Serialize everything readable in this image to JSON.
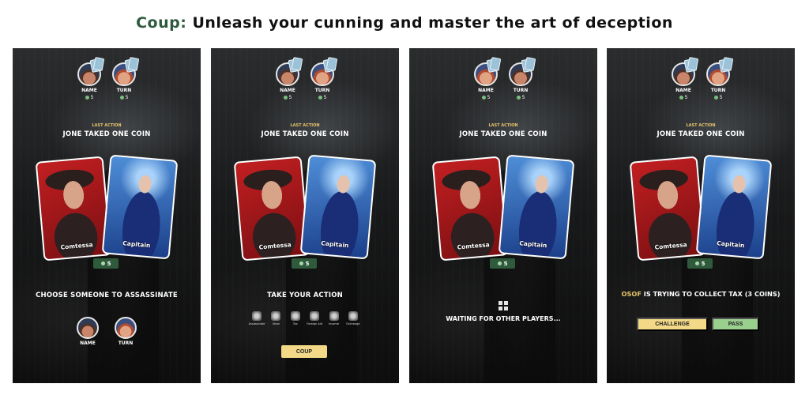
{
  "header": {
    "brand": "Coup:",
    "tagline": "Unleash your cunning and master the art of deception"
  },
  "players": [
    {
      "name": "Name",
      "coins": "5"
    },
    {
      "name": "Turn",
      "coins": "5"
    }
  ],
  "last_action": {
    "label": "Last Action",
    "text": "Jone taked one coin"
  },
  "cards": [
    {
      "name": "Comtessa"
    },
    {
      "name": "Capitain"
    }
  ],
  "my_coins": "5",
  "screens": {
    "assassinate": {
      "prompt": "Choose someone to assassinate",
      "targets": [
        {
          "name": "Name"
        },
        {
          "name": "Turn"
        }
      ]
    },
    "action": {
      "prompt": "Take your action",
      "actions": [
        {
          "label": "Assassinate",
          "icon": "skull-icon"
        },
        {
          "label": "Steal",
          "icon": "hand-icon"
        },
        {
          "label": "Tax",
          "icon": "coins-icon"
        },
        {
          "label": "Foreign Aid",
          "icon": "coins-stack-icon"
        },
        {
          "label": "Income",
          "icon": "coin-icon"
        },
        {
          "label": "Exchange",
          "icon": "cards-icon"
        }
      ],
      "coup_label": "Coup"
    },
    "waiting": {
      "text": "Waiting for other players..."
    },
    "challenge": {
      "who": "Osof",
      "rest": " is trying to collect Tax (3 coins)",
      "challenge_label": "Challenge",
      "pass_label": "Pass"
    }
  },
  "colors": {
    "brand": "#2e5b3d",
    "accent_yellow": "#f3d987",
    "accent_green": "#9ad08e",
    "badge": "#2f5a3b",
    "label_gold": "#e7c46b"
  }
}
